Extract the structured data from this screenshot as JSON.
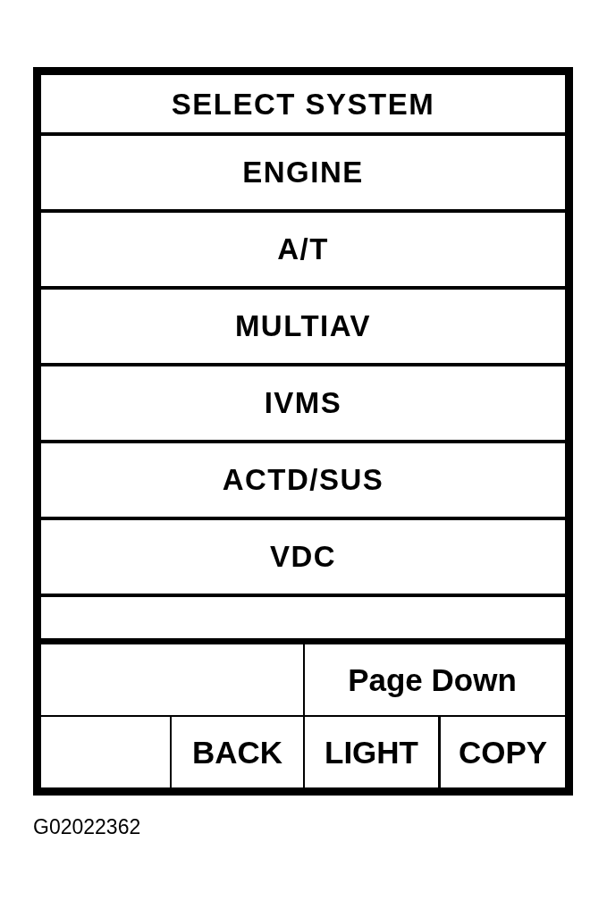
{
  "screen": {
    "title": "SELECT SYSTEM",
    "systems": [
      {
        "label": "ENGINE"
      },
      {
        "label": "A/T"
      },
      {
        "label": "MULTIAV"
      },
      {
        "label": "IVMS"
      },
      {
        "label": "ACTD/SUS"
      },
      {
        "label": "VDC"
      }
    ],
    "page_button": "Page Down",
    "buttons": [
      "BACK",
      "LIGHT",
      "COPY"
    ]
  },
  "figure_id": "G02022362"
}
